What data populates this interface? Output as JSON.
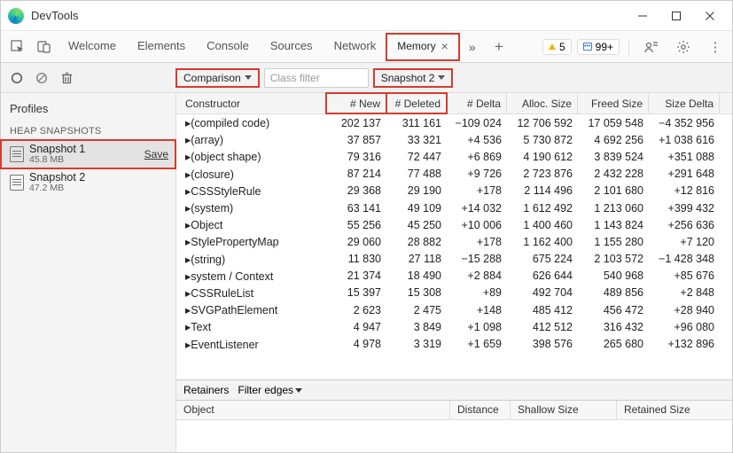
{
  "window": {
    "title": "DevTools"
  },
  "tabs": {
    "items": [
      "Welcome",
      "Elements",
      "Console",
      "Sources",
      "Network",
      "Memory"
    ],
    "active": "Memory",
    "warn_count": "5",
    "msg_count": "99+"
  },
  "toolbar": {
    "mode": "Comparison",
    "class_filter_placeholder": "Class filter",
    "baseline": "Snapshot 2"
  },
  "sidebar": {
    "title": "Profiles",
    "section": "HEAP SNAPSHOTS",
    "snapshots": [
      {
        "name": "Snapshot 1",
        "size": "45.8 MB",
        "save": "Save",
        "active": true
      },
      {
        "name": "Snapshot 2",
        "size": "47.2 MB",
        "active": false
      }
    ]
  },
  "table": {
    "headers": [
      "Constructor",
      "# New",
      "# Deleted",
      "# Delta",
      "Alloc. Size",
      "Freed Size",
      "Size Delta"
    ],
    "rows": [
      {
        "c": "(compiled code)",
        "n": "202 137",
        "d": "311 161",
        "dl": "−109 024",
        "a": "12 706 592",
        "f": "17 059 548",
        "s": "−4 352 956"
      },
      {
        "c": "(array)",
        "n": "37 857",
        "d": "33 321",
        "dl": "+4 536",
        "a": "5 730 872",
        "f": "4 692 256",
        "s": "+1 038 616"
      },
      {
        "c": "(object shape)",
        "n": "79 316",
        "d": "72 447",
        "dl": "+6 869",
        "a": "4 190 612",
        "f": "3 839 524",
        "s": "+351 088"
      },
      {
        "c": "(closure)",
        "n": "87 214",
        "d": "77 488",
        "dl": "+9 726",
        "a": "2 723 876",
        "f": "2 432 228",
        "s": "+291 648"
      },
      {
        "c": "CSSStyleRule",
        "n": "29 368",
        "d": "29 190",
        "dl": "+178",
        "a": "2 114 496",
        "f": "2 101 680",
        "s": "+12 816"
      },
      {
        "c": "(system)",
        "n": "63 141",
        "d": "49 109",
        "dl": "+14 032",
        "a": "1 612 492",
        "f": "1 213 060",
        "s": "+399 432"
      },
      {
        "c": "Object",
        "n": "55 256",
        "d": "45 250",
        "dl": "+10 006",
        "a": "1 400 460",
        "f": "1 143 824",
        "s": "+256 636"
      },
      {
        "c": "StylePropertyMap",
        "n": "29 060",
        "d": "28 882",
        "dl": "+178",
        "a": "1 162 400",
        "f": "1 155 280",
        "s": "+7 120"
      },
      {
        "c": "(string)",
        "n": "11 830",
        "d": "27 118",
        "dl": "−15 288",
        "a": "675 224",
        "f": "2 103 572",
        "s": "−1 428 348"
      },
      {
        "c": "system / Context",
        "n": "21 374",
        "d": "18 490",
        "dl": "+2 884",
        "a": "626 644",
        "f": "540 968",
        "s": "+85 676"
      },
      {
        "c": "CSSRuleList",
        "n": "15 397",
        "d": "15 308",
        "dl": "+89",
        "a": "492 704",
        "f": "489 856",
        "s": "+2 848"
      },
      {
        "c": "SVGPathElement",
        "n": "2 623",
        "d": "2 475",
        "dl": "+148",
        "a": "485 412",
        "f": "456 472",
        "s": "+28 940"
      },
      {
        "c": "Text",
        "n": "4 947",
        "d": "3 849",
        "dl": "+1 098",
        "a": "412 512",
        "f": "316 432",
        "s": "+96 080"
      },
      {
        "c": "EventListener",
        "n": "4 978",
        "d": "3 319",
        "dl": "+1 659",
        "a": "398 576",
        "f": "265 680",
        "s": "+132 896"
      }
    ]
  },
  "retainers": {
    "title": "Retainers",
    "filter": "Filter edges",
    "cols": [
      "Object",
      "Distance",
      "Shallow Size",
      "Retained Size"
    ]
  }
}
